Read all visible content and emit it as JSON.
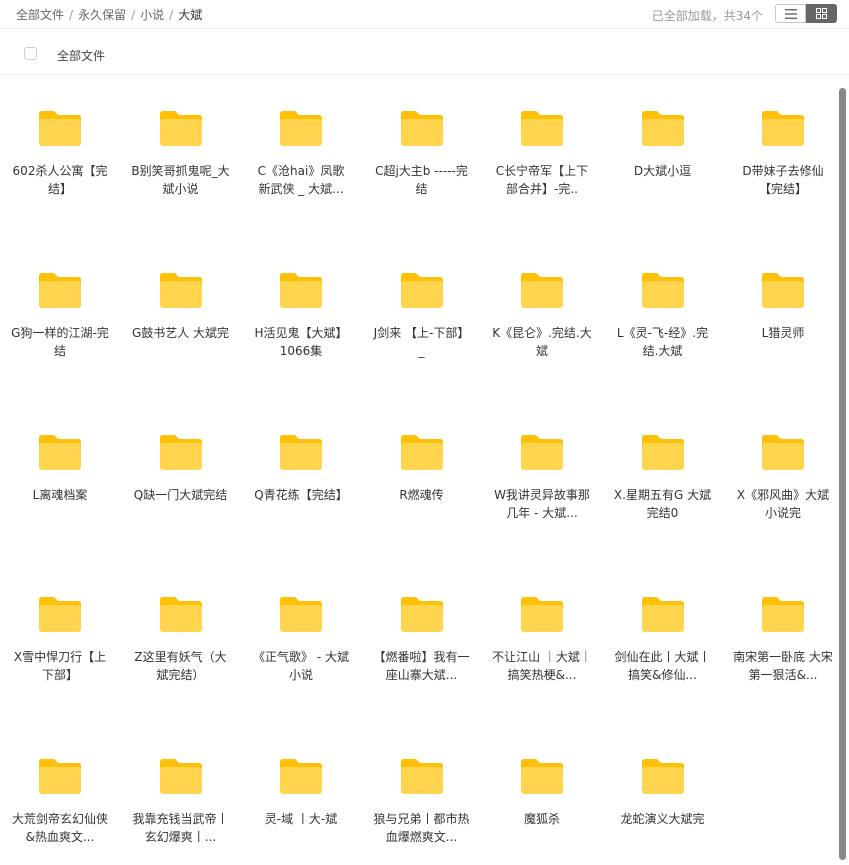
{
  "breadcrumb": {
    "items": [
      "全部文件",
      "永久保留",
      "小说"
    ],
    "current": "大斌"
  },
  "status": {
    "loaded_text": "已全部加载，共34个"
  },
  "view_toggle": {
    "list_icon": "list-icon",
    "grid_icon": "grid-icon",
    "active": "grid"
  },
  "header": {
    "select_all_label": "全部文件"
  },
  "colors": {
    "folder_body": "#FFD54F",
    "folder_back": "#FFC107",
    "active_toggle": "#666666"
  },
  "folders": [
    "602杀人公寓【完结】",
    "B别笑哥抓鬼呢_大斌小说",
    "C《沧hai》凤歌 新武侠 _ 大斌...",
    "C超j大主b -----完结",
    "C长宁帝军【上下部合并】-完..",
    "D大斌小逗",
    "D带妹子去修仙【完结】",
    "G狗一样的江湖-完结",
    "G鼓书艺人 大斌完",
    "H活见鬼【大斌】1066集",
    "J剑来 【上-下部】_",
    "K《昆仑》.完结.大斌",
    "L《灵-飞-经》.完结.大斌",
    "L猎灵师",
    "L离魂档案",
    "Q缺一门大斌完结",
    "Q青花练【完结】",
    "R燃魂传",
    "W我讲灵异故事那几年 - 大斌...",
    "X.星期五有G 大斌 完结0",
    "X《邪风曲》大斌小说完",
    "X雪中悍刀行【上下部】",
    "Z这里有妖气（大斌完结）",
    "《正气歌》 - 大斌小说",
    "【燃番啦】我有一座山寨大斌...",
    "不让江山 ｜大斌｜搞笑热梗&...",
    "剑仙在此丨大斌丨搞笑&修仙...",
    "南宋第一卧底 大宋第一狠活&...",
    "大荒剑帝玄幻仙侠&热血爽文...",
    "我靠充钱当武帝丨玄幻爆爽丨...",
    "灵-域 丨大-斌",
    "狼与兄弟丨都市热血爆燃爽文...",
    "魔狐杀",
    "龙蛇演义大斌完"
  ]
}
